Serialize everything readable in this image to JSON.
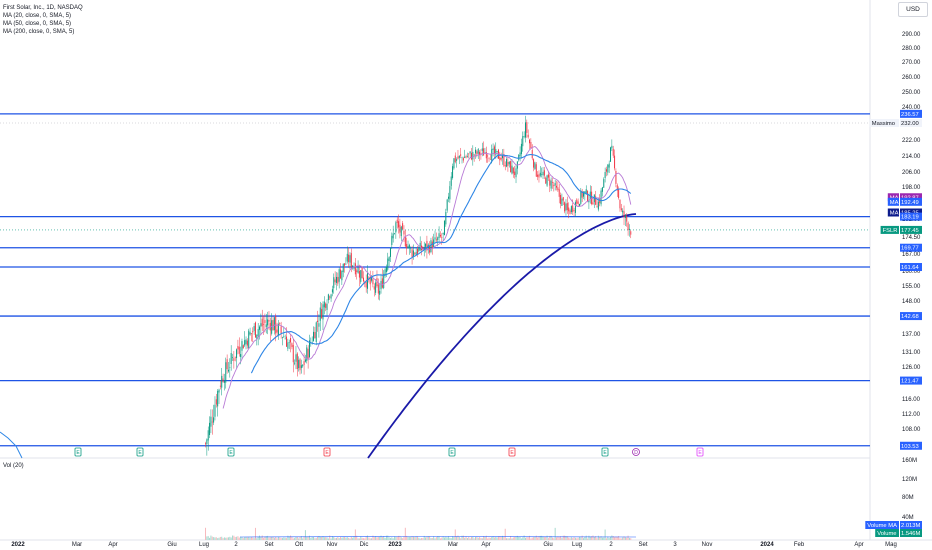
{
  "legend": {
    "title": "First Solar, Inc., 1D, NASDAQ",
    "ma20": "MA (20, close, 0, SMA, 5)",
    "ma50": "MA (50, close, 0, SMA, 5)",
    "ma200": "MA (200, close, 0, SMA, 5)"
  },
  "currency": "USD",
  "volume_label": "Vol (20)",
  "chart_data": {
    "type": "candlestick",
    "price_axis_ticks": [
      290,
      280,
      270,
      260,
      250,
      240,
      232,
      222,
      214,
      206,
      198,
      190,
      182,
      174.5,
      167,
      160,
      155,
      148,
      142,
      137,
      131,
      126,
      121,
      116,
      112,
      108
    ],
    "time_axis_labels": [
      "2022",
      "Mar",
      "Apr",
      "Giu",
      "Lug",
      "2",
      "Set",
      "Ott",
      "Nov",
      "Dic",
      "2023",
      "Mar",
      "Apr",
      "Giu",
      "Lug",
      "2",
      "Set",
      "3",
      "Nov",
      "2024",
      "Feb",
      "Apr",
      "Mag"
    ],
    "volume_axis_ticks": [
      "160M",
      "120M",
      "80M",
      "40M"
    ],
    "horizontal_levels": [
      236.57,
      183.19,
      169.77,
      161.64,
      142.68,
      121.47,
      103.53
    ],
    "price_tags": [
      {
        "label": "",
        "value": "236.57",
        "price": 236.57,
        "color": "#2962ff"
      },
      {
        "label": "Massimo",
        "value": "232.00",
        "price": 232.0,
        "color": "#ffffff"
      },
      {
        "label": "MA",
        "value": "192.87",
        "price": 192.87,
        "color": "#9c27b0"
      },
      {
        "label": "MA",
        "value": "192.49",
        "price": 190.6,
        "color": "#2962ff"
      },
      {
        "label": "MA",
        "value": "185.25",
        "price": 185.25,
        "color": "#0d1b8c"
      },
      {
        "label": "",
        "value": "183.19",
        "price": 183.19,
        "color": "#2962ff"
      },
      {
        "label": "FSLR",
        "value": "177.45",
        "price": 177.45,
        "color": "#089981"
      },
      {
        "label": "",
        "value": "169.77",
        "price": 169.77,
        "color": "#2962ff"
      },
      {
        "label": "",
        "value": "161.64",
        "price": 161.64,
        "color": "#2962ff"
      },
      {
        "label": "",
        "value": "142.68",
        "price": 142.68,
        "color": "#2962ff"
      },
      {
        "label": "",
        "value": "121.47",
        "price": 121.47,
        "color": "#2962ff"
      },
      {
        "label": "",
        "value": "103.53",
        "price": 103.53,
        "color": "#2962ff"
      }
    ],
    "volume_tags": [
      {
        "label": "Volume MA",
        "value": "2.013M",
        "color": "#2962ff"
      },
      {
        "label": "Volume",
        "value": "1.546M",
        "color": "#089981"
      }
    ],
    "event_markers": [
      {
        "type": "E",
        "color": "#089981",
        "x_label": "2022-02"
      },
      {
        "type": "E",
        "color": "#089981",
        "x_label": "2022-04"
      },
      {
        "type": "E",
        "color": "#089981",
        "x_label": "2022-07"
      },
      {
        "type": "E",
        "color": "#f23645",
        "x_label": "2022-10"
      },
      {
        "type": "E",
        "color": "#089981",
        "x_label": "2023-02"
      },
      {
        "type": "E",
        "color": "#f23645",
        "x_label": "2023-04"
      },
      {
        "type": "E",
        "color": "#089981",
        "x_label": "2023-07"
      },
      {
        "type": "D",
        "color": "#9c27b0",
        "x_label": "2023-08"
      },
      {
        "type": "E",
        "color": "#e040fb",
        "x_label": "2023-10"
      }
    ],
    "series": [
      {
        "name": "MA (20, close, 0, SMA, 5)",
        "color": "#b87ad6"
      },
      {
        "name": "MA (50, close, 0, SMA, 5)",
        "color": "#2e86e6"
      },
      {
        "name": "MA (200, close, 0, SMA, 5)",
        "color": "#1a1aa8"
      }
    ],
    "price_path": [
      [
        "2022-07-05",
        104
      ],
      [
        "2022-07-20",
        122
      ],
      [
        "2022-08-05",
        132
      ],
      [
        "2022-08-20",
        138
      ],
      [
        "2022-09-05",
        141
      ],
      [
        "2022-09-20",
        136
      ],
      [
        "2022-10-05",
        124
      ],
      [
        "2022-10-20",
        140
      ],
      [
        "2022-11-05",
        155
      ],
      [
        "2022-11-20",
        165
      ],
      [
        "2022-12-05",
        158
      ],
      [
        "2022-12-20",
        152
      ],
      [
        "2023-01-05",
        180
      ],
      [
        "2023-01-20",
        168
      ],
      [
        "2023-02-05",
        170
      ],
      [
        "2023-02-20",
        175
      ],
      [
        "2023-03-01",
        212
      ],
      [
        "2023-03-15",
        214
      ],
      [
        "2023-04-01",
        216
      ],
      [
        "2023-04-15",
        214
      ],
      [
        "2023-05-01",
        205
      ],
      [
        "2023-05-10",
        230
      ],
      [
        "2023-05-20",
        206
      ],
      [
        "2023-06-05",
        200
      ],
      [
        "2023-06-20",
        185
      ],
      [
        "2023-07-05",
        195
      ],
      [
        "2023-07-20",
        190
      ],
      [
        "2023-08-01",
        218
      ],
      [
        "2023-08-10",
        186
      ],
      [
        "2023-08-20",
        177.45
      ]
    ]
  }
}
